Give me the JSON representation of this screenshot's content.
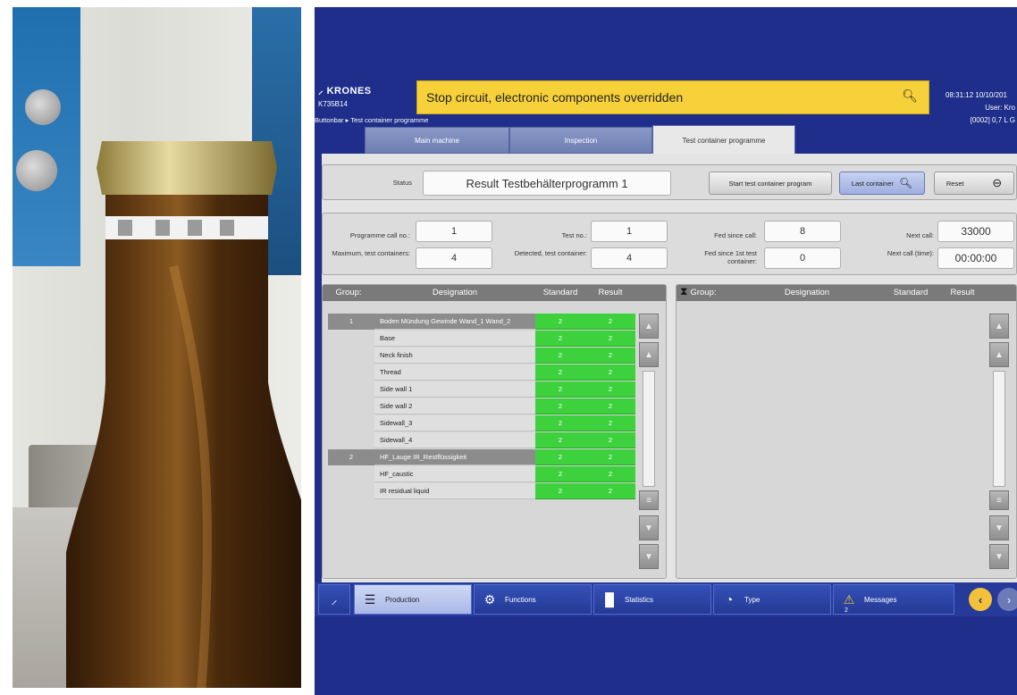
{
  "header": {
    "brand": "KRONES",
    "machine_id": "K735B14",
    "alarm_text": "Stop circuit, electronic components overridden",
    "datetime": "08:31:12  10/10/201",
    "user": "User: Kro",
    "product": "[0002]  0,7 L G",
    "breadcrumb": "Buttonbar ▸ Test container programme"
  },
  "tabs": [
    "Main machine",
    "Inspection",
    "Test container programme"
  ],
  "status": {
    "label": "Status",
    "value": "Result Testbehälterprogramm 1",
    "start_button": "Start test container program",
    "last_container_button": "Last container",
    "reset_button": "Reset"
  },
  "counters": {
    "programme_call_label": "Programme call no.:",
    "programme_call_value": "1",
    "max_test_label": "Maximum, test containers:",
    "max_test_value": "4",
    "test_no_label": "Test no.:",
    "test_no_value": "1",
    "detected_label": "Detected, test container:",
    "detected_value": "4",
    "fed_since_call_label": "Fed since call:",
    "fed_since_call_value": "8",
    "fed_since_first_label": "Fed since 1st test container:",
    "fed_since_first_value": "0",
    "next_call_label": "Next call:",
    "next_call_value": "33000",
    "next_call_time_label": "Next call (time):",
    "next_call_time_value": "00:00:00"
  },
  "table": {
    "headers": [
      "Group:",
      "Designation",
      "Standard",
      "Result"
    ],
    "rows": [
      {
        "group": "1",
        "designation": "Boden Mündung Gewinde Wand_1 Wand_2",
        "standard": "2",
        "result": "2",
        "is_group": true
      },
      {
        "group": "",
        "designation": "Base",
        "standard": "2",
        "result": "2",
        "is_group": false
      },
      {
        "group": "",
        "designation": "Neck finish",
        "standard": "2",
        "result": "2",
        "is_group": false
      },
      {
        "group": "",
        "designation": "Thread",
        "standard": "2",
        "result": "2",
        "is_group": false
      },
      {
        "group": "",
        "designation": "Side wall 1",
        "standard": "2",
        "result": "2",
        "is_group": false
      },
      {
        "group": "",
        "designation": "Side wall 2",
        "standard": "2",
        "result": "2",
        "is_group": false
      },
      {
        "group": "",
        "designation": "Sidewall_3",
        "standard": "2",
        "result": "2",
        "is_group": false
      },
      {
        "group": "",
        "designation": "Sidewall_4",
        "standard": "2",
        "result": "2",
        "is_group": false
      },
      {
        "group": "2",
        "designation": "HF_Lauge IR_Restflüssigkeit",
        "standard": "2",
        "result": "2",
        "is_group": true
      },
      {
        "group": "",
        "designation": "HF_caustic",
        "standard": "2",
        "result": "2",
        "is_group": false
      },
      {
        "group": "",
        "designation": "IR residual liquid",
        "standard": "2",
        "result": "2",
        "is_group": false
      }
    ]
  },
  "table2": {
    "headers": [
      "Group:",
      "Designation",
      "Standard",
      "Result"
    ]
  },
  "nav": {
    "production": "Production",
    "functions": "Functions",
    "statistics": "Statistics",
    "type": "Type",
    "messages": "Messages",
    "messages_count": "2"
  },
  "colors": {
    "hmi_background": "#1e2e8a",
    "alarm_yellow": "#f7d13a",
    "ok_green": "#3ed13e"
  }
}
